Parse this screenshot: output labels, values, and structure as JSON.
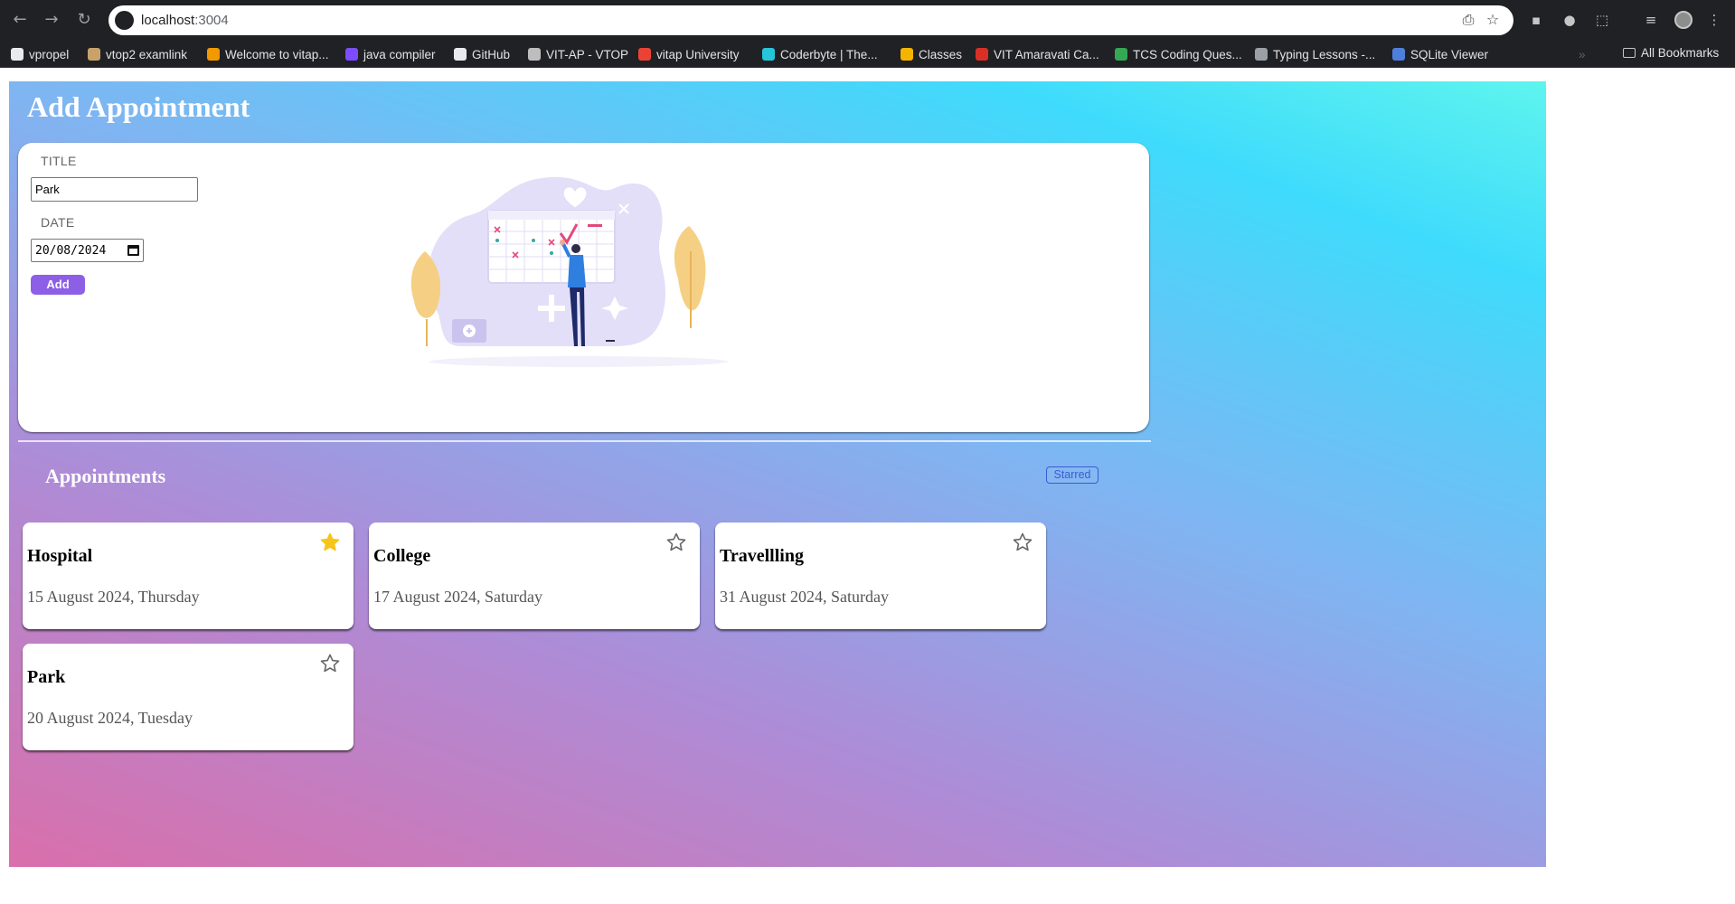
{
  "browser": {
    "url_host": "localhost",
    "url_port": ":3004",
    "bookmarks": [
      {
        "label": "vpropel",
        "color": "#e8eaed"
      },
      {
        "label": "vtop2 examlink",
        "color": "#c9a26b"
      },
      {
        "label": "Welcome to vitap...",
        "color": "#f29900"
      },
      {
        "label": "java compiler",
        "color": "#7c4dff"
      },
      {
        "label": "GitHub",
        "color": "#e8eaed"
      },
      {
        "label": "VIT-AP - VTOP",
        "color": "#bdbdbd"
      },
      {
        "label": "vitap University",
        "color": "#ea4335"
      },
      {
        "label": "Coderbyte | The...",
        "color": "#26c6da"
      },
      {
        "label": "Classes",
        "color": "#f4b400"
      },
      {
        "label": "VIT Amaravati Ca...",
        "color": "#d93025"
      },
      {
        "label": "TCS Coding Ques...",
        "color": "#34a853"
      },
      {
        "label": "Typing Lessons -...",
        "color": "#9aa0a6"
      },
      {
        "label": "SQLite Viewer",
        "color": "#4f7fdc"
      }
    ],
    "all_bookmarks": "All Bookmarks"
  },
  "app": {
    "title": "Add Appointment",
    "form": {
      "title_label": "TITLE",
      "title_value": "Park",
      "date_label": "DATE",
      "date_value": "20/08/2024",
      "add_label": "Add"
    },
    "list_heading": "Appointments",
    "starred_label": "Starred"
  },
  "appointments": [
    {
      "title": "Hospital",
      "date": "15 August 2024, Thursday",
      "starred": true
    },
    {
      "title": "College",
      "date": "17 August 2024, Saturday",
      "starred": false
    },
    {
      "title": "Travellling",
      "date": "31 August 2024, Saturday",
      "starred": false
    },
    {
      "title": "Park",
      "date": "20 August 2024, Tuesday",
      "starred": false
    }
  ],
  "colors": {
    "accent_button": "#8d5fe6",
    "star_filled": "#f5c518",
    "star_outline": "#666666"
  }
}
